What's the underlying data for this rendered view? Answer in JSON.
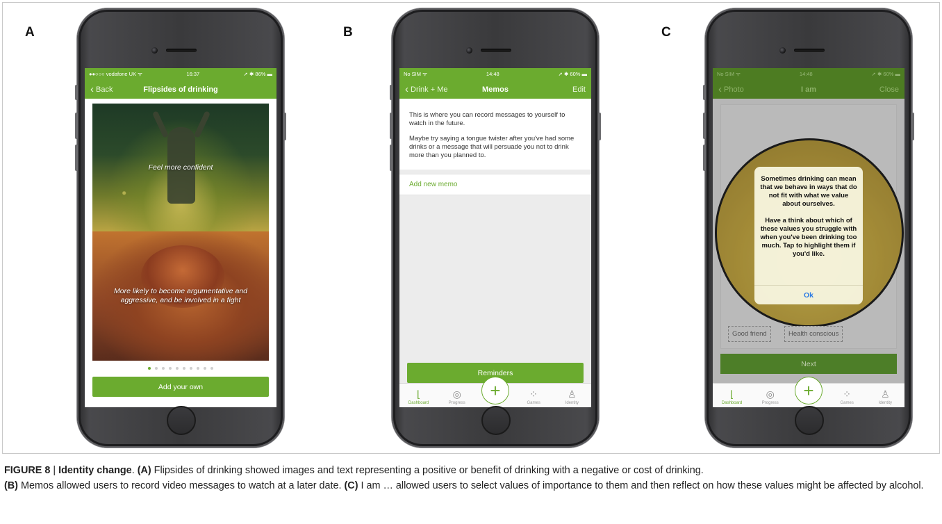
{
  "panels": {
    "a": {
      "letter": "A"
    },
    "b": {
      "letter": "B"
    },
    "c": {
      "letter": "C"
    }
  },
  "screen_a": {
    "status": {
      "carrier": "●●○○○ vodafone UK ᯤ",
      "time": "16:37",
      "battery": "➚ ✱ 86% ▬"
    },
    "nav": {
      "back": "Back",
      "title": "Flipsides of drinking"
    },
    "card_top_text": "Feel more confident",
    "card_bottom_text": "More likely to become argumentative and aggressive, and be involved in a fight",
    "page_dots": {
      "total": 10,
      "active_index": 0
    },
    "add_button": "Add your own"
  },
  "screen_b": {
    "status": {
      "carrier": "No SIM ᯤ",
      "time": "14:48",
      "battery": "➚ ✱ 60% ▬"
    },
    "nav": {
      "back": "Drink + Me",
      "title": "Memos",
      "right": "Edit"
    },
    "intro_1": "This is where you can record messages to yourself to watch in the future.",
    "intro_2": "Maybe try saying a tongue twister after you've had some drinks or a message that will persuade you not to drink more than you planned to.",
    "add_memo": "Add new memo",
    "reminders_button": "Reminders"
  },
  "screen_c": {
    "status": {
      "carrier": "No SIM ᯤ",
      "time": "14:48",
      "battery": "➚ ✱ 60% ▬"
    },
    "nav": {
      "back": "Photo",
      "title": "I am",
      "right": "Close"
    },
    "alert_para_1": "Sometimes drinking can mean that we behave in ways that do not fit with what we value about ourselves.",
    "alert_para_2": "Have a think about which of these values you struggle with when you've been drinking too much. Tap to highlight them if you'd like.",
    "alert_ok": "Ok",
    "tags": [
      "Good friend",
      "Health conscious"
    ],
    "next_button": "Next"
  },
  "tabbar": {
    "items": [
      {
        "label": "Dashboard",
        "icon": "dashboard-icon",
        "glyph": "⌊"
      },
      {
        "label": "Progress",
        "icon": "target-icon",
        "glyph": "◎"
      },
      {
        "label": "",
        "icon": "plus-icon",
        "glyph": "+"
      },
      {
        "label": "Games",
        "icon": "games-icon",
        "glyph": "⁘"
      },
      {
        "label": "Identity",
        "icon": "person-icon",
        "glyph": "♙"
      }
    ]
  },
  "caption": {
    "fig_label": "FIGURE 8",
    "sep": " | ",
    "title": "Identity change",
    "intro": ". ",
    "a_label": "(A)",
    "a_text": " Flipsides of drinking showed images and text representing a positive or benefit of drinking with a negative or cost of drinking. ",
    "b_label": "(B)",
    "b_text": " Memos allowed users to record video messages to watch at a later date. ",
    "c_label": "(C)",
    "c_text": " I am … allowed users to select values of importance to them and then reflect on how these values might be affected by alcohol."
  },
  "colors": {
    "brand_green": "#6bab2f",
    "alert_ok_blue": "#2c7be5",
    "dot_inactive": "#cfcfcf"
  }
}
